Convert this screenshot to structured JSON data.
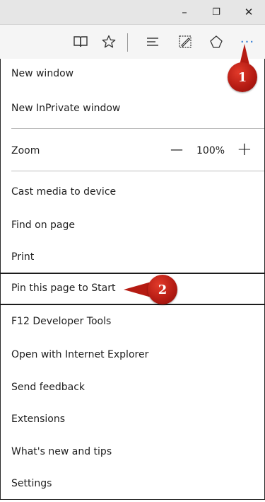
{
  "titlebar": {
    "minimize_glyph": "–",
    "restore_glyph": "❐",
    "close_glyph": "✕"
  },
  "toolbar": {
    "icons": [
      "reading-view-icon",
      "favorite-star-icon",
      "hub-icon",
      "web-note-icon",
      "share-icon",
      "more-icon"
    ],
    "more_glyph": "···"
  },
  "menu": {
    "items": [
      "New window",
      "New InPrivate window",
      "Zoom",
      "Cast media to device",
      "Find on page",
      "Print",
      "Pin this page to Start",
      "F12 Developer Tools",
      "Open with Internet Explorer",
      "Send feedback",
      "Extensions",
      "What's new and tips",
      "Settings"
    ],
    "zoom": {
      "minus_glyph": "—",
      "value": "100%",
      "plus_glyph": "+"
    }
  },
  "callouts": {
    "step1": "1",
    "step2": "2"
  },
  "colors": {
    "callout_red": "#b51b12",
    "titlebar_bg": "#e6e6e6",
    "toolbar_bg": "#f5f5f5"
  }
}
